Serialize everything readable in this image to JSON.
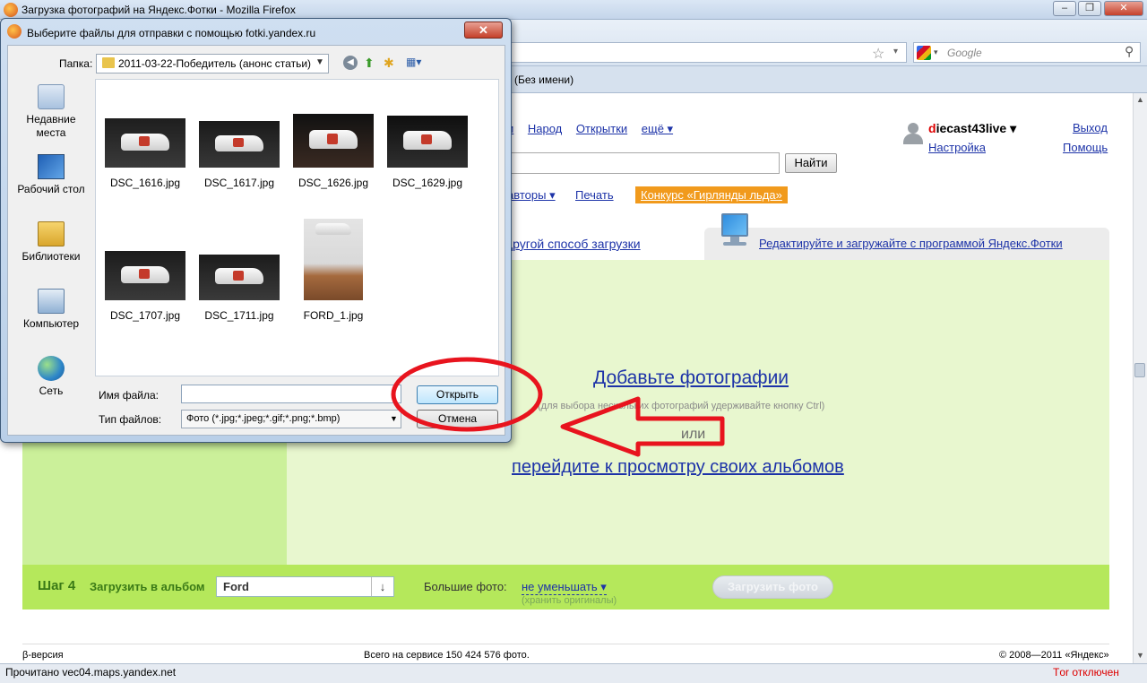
{
  "browser": {
    "title": "Загрузка фотографий на Яндекс.Фотки - Mozilla Firefox",
    "search_placeholder": "Google",
    "tab_label": "(Без имени)",
    "status_text": "Прочитано vec04.maps.yandex.net",
    "tor_status": "Тor отключен"
  },
  "page": {
    "nav_links": [
      "и",
      "Народ",
      "Открытки",
      "ещё ▾"
    ],
    "user": {
      "first_letter": "d",
      "rest": "iecast43live ▾"
    },
    "settings_link": "Настройка",
    "logout_link": "Выход",
    "help_link": "Помощь",
    "find_button": "Найти",
    "authors_link": "авторы ▾",
    "print_link": "Печать",
    "contest_badge": "Конкурс «Гирлянды льда»",
    "other_method_link": "другой способ загрузки",
    "editor_link": "Редактируйте и загружайте с программой Яндекс.Фотки",
    "add_photos_link": "Добавьте фотографии",
    "ctrl_hint": "(для выбора нескольких фотографий удерживайте кнопку Ctrl)",
    "or_text": "или",
    "albums_link": "перейдите к просмотру своих альбомов",
    "step4": {
      "title": "Шаг 4",
      "album_label": "Загрузить в альбом",
      "album_value": "Ford",
      "bigphoto_label": "Большие фото:",
      "bigphoto_value": "не уменьшать ▾",
      "bigphoto_hint": "(хранить оригиналы)",
      "upload_button": "Загрузить фото"
    },
    "footer": {
      "beta": "β-версия",
      "total": "Всего на сервисе 150 424 576 фото.",
      "copyright": "© 2008—2011 «Яндекс»"
    }
  },
  "dialog": {
    "title": "Выберите файлы для отправки с помощью fotki.yandex.ru",
    "folder_label": "Папка:",
    "folder_name": "2011-03-22-Победитель (анонс статьи)",
    "places": [
      "Недавние места",
      "Рабочий стол",
      "Библиотеки",
      "Компьютер",
      "Сеть"
    ],
    "files": [
      "DSC_1616.jpg",
      "DSC_1617.jpg",
      "DSC_1626.jpg",
      "DSC_1629.jpg",
      "DSC_1707.jpg",
      "DSC_1711.jpg",
      "FORD_1.jpg"
    ],
    "filename_label": "Имя файла:",
    "filename_value": "",
    "filetype_label": "Тип файлов:",
    "filetype_value": "Фото (*.jpg;*.jpeg;*.gif;*.png;*.bmp)",
    "open_button": "Открыть",
    "cancel_button": "Отмена",
    "close_glyph": "✕"
  },
  "colors": {
    "annotation_red": "#e8141e",
    "upload_green": "#b5e85b",
    "contest_orange": "#f19a1c",
    "link_blue": "#1d33a8"
  }
}
